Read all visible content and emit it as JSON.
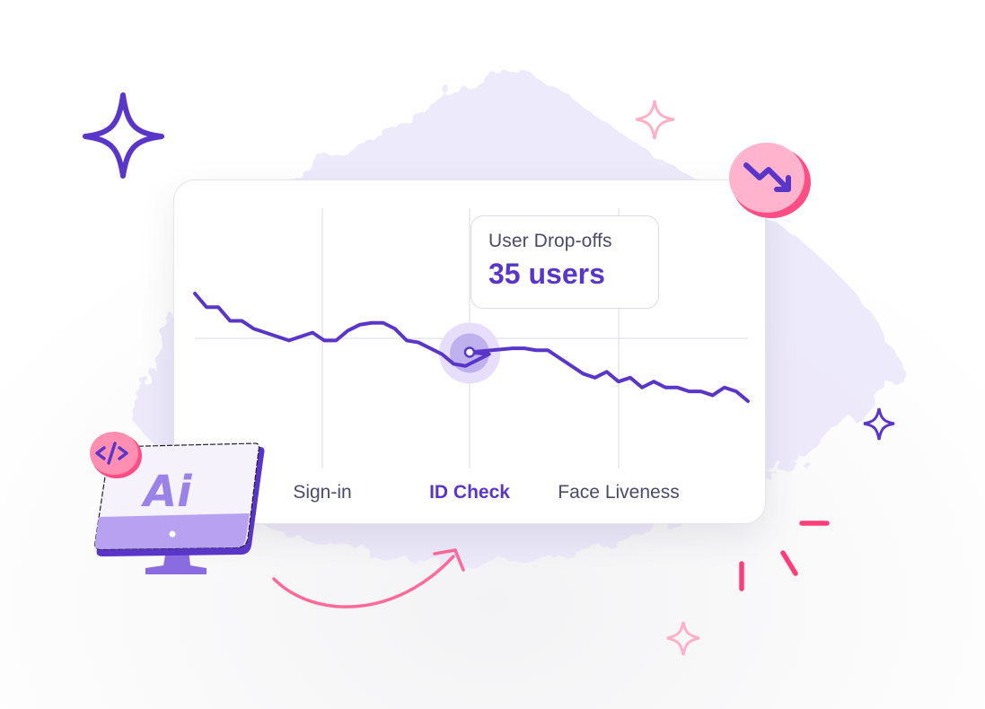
{
  "tooltip": {
    "label": "User Drop-offs",
    "value": "35 users"
  },
  "colors": {
    "line": "#5a36c8",
    "accent_pink": "#ff5c8a",
    "badge_pink": "#ffb3cc",
    "wash": "#ece8fb",
    "grid": "#e6e6ec"
  },
  "icons": {
    "trend_badge": "trending-down-icon",
    "code_badge": "code-icon",
    "monitor": "ai-monitor-icon",
    "sparkles": "sparkle-icon",
    "arrow": "curved-arrow-icon"
  },
  "chart_data": {
    "type": "line",
    "title": "",
    "xlabel": "",
    "ylabel": "",
    "categories": [
      "Sign-in",
      "ID Check",
      "Face Liveness"
    ],
    "highlighted_category": "ID Check",
    "highlight_index": 26,
    "grid": true,
    "legend": "none",
    "x_range": [
      0,
      50
    ],
    "y_range": [
      0,
      100
    ],
    "category_positions": [
      11.5,
      25.5,
      39.5
    ],
    "series": [
      {
        "name": "User Drop-offs",
        "values": [
          85,
          78,
          78,
          71,
          71,
          67,
          65,
          63,
          61,
          63,
          65,
          61,
          61,
          66,
          69,
          70,
          70,
          67,
          61,
          60,
          57,
          54,
          49,
          48,
          51,
          54,
          55,
          57,
          57,
          56,
          56,
          52,
          48,
          44,
          42,
          45,
          40,
          42,
          37,
          40,
          37,
          37,
          35,
          35,
          33,
          37,
          35,
          30
        ]
      }
    ]
  }
}
